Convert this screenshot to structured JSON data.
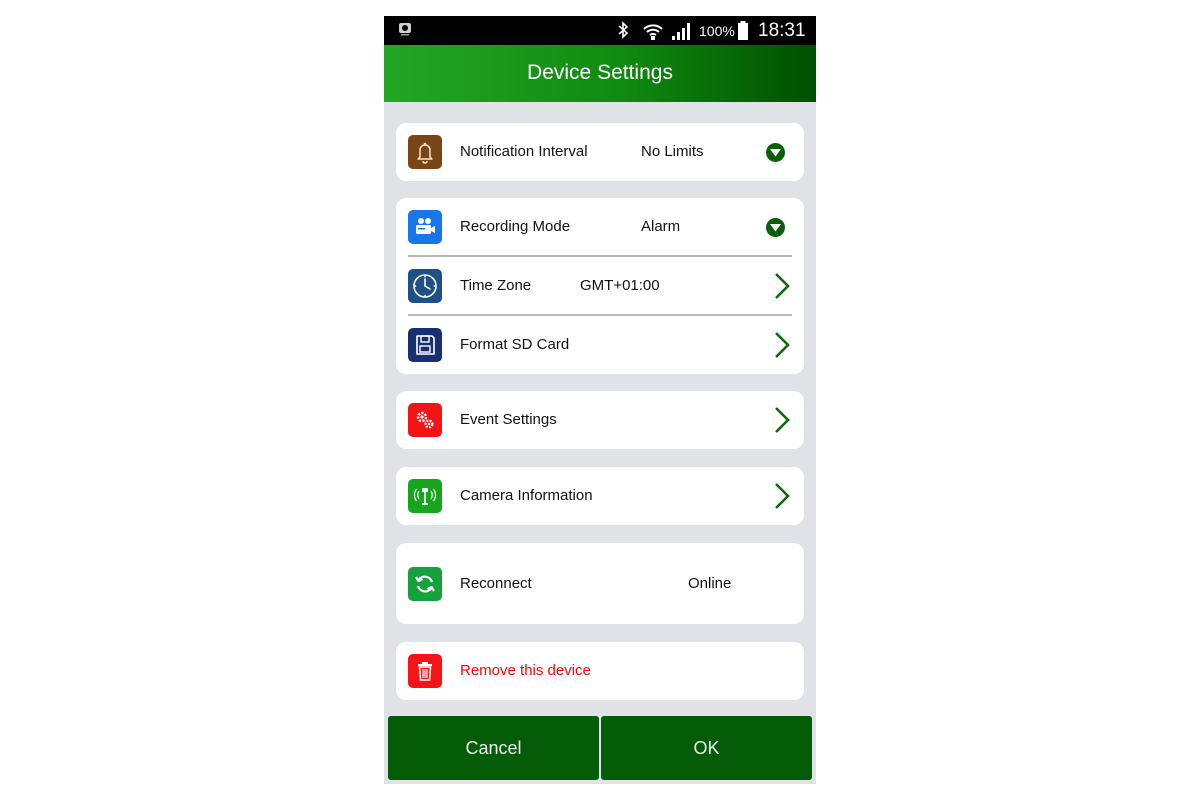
{
  "status_bar": {
    "battery": "100%",
    "time": "18:31",
    "icons": [
      "app-notification-icon",
      "bluetooth-icon",
      "wifi-icon",
      "signal-icon",
      "battery-icon"
    ]
  },
  "header": {
    "title": "Device Settings"
  },
  "settings": {
    "notification": {
      "label": "Notification Interval",
      "value": "No Limits",
      "icon": "bell-icon"
    },
    "recording": {
      "label": "Recording Mode",
      "value": "Alarm",
      "icon": "video-camera-icon"
    },
    "timezone": {
      "label": "Time Zone",
      "value": "GMT+01:00",
      "icon": "clock-icon"
    },
    "format_sd": {
      "label": "Format SD Card",
      "icon": "sd-card-icon"
    },
    "events": {
      "label": "Event Settings",
      "icon": "gears-icon"
    },
    "camera_info": {
      "label": "Camera Information",
      "icon": "camera-antenna-icon"
    },
    "reconnect": {
      "label": "Reconnect",
      "value": "Online",
      "icon": "refresh-icon"
    },
    "remove": {
      "label": "Remove this device",
      "icon": "trash-icon"
    }
  },
  "footer": {
    "cancel_label": "Cancel",
    "ok_label": "OK"
  },
  "colors": {
    "header_gradient_start": "#24a624",
    "header_gradient_end": "#004f00",
    "button_green": "#045c08",
    "dropdown_green": "#0b5f0b",
    "chevron_green": "#0b6b0b",
    "danger_red": "#ff0000",
    "page_background": "#e1e1e8"
  }
}
